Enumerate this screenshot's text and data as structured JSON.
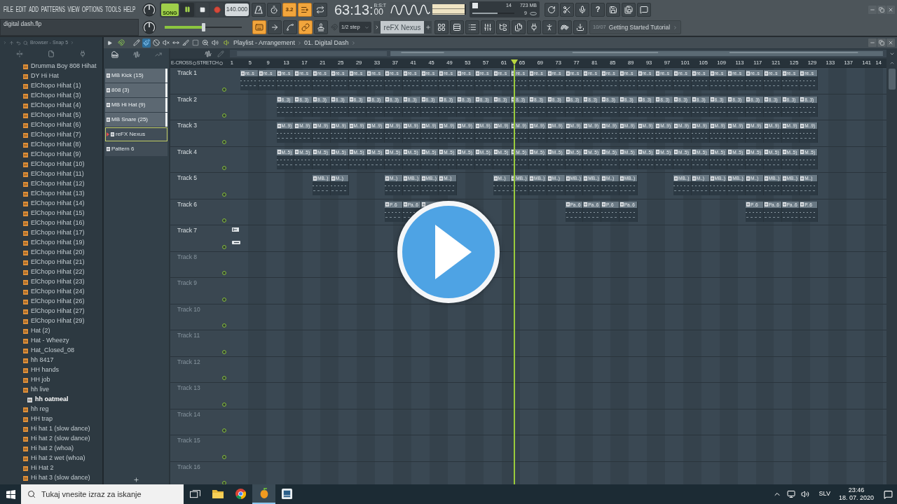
{
  "menu_bar": {
    "items": [
      "FILE",
      "EDIT",
      "ADD",
      "PATTERNS",
      "VIEW",
      "OPTIONS",
      "TOOLS",
      "HELP"
    ]
  },
  "hint_bar": {
    "text": "digital dash.flp"
  },
  "transport": {
    "mode_label": "SONG",
    "song_mode": true,
    "playing": true,
    "tempo": "140.000",
    "master_volume": {
      "level": 0.5
    }
  },
  "time_display": {
    "value": "63:13:",
    "ticks": "00",
    "format": "B:S:T"
  },
  "output_meter": {
    "level": 0.95
  },
  "performance": {
    "cpu": "14",
    "memory": "723 MB",
    "polyphony": "9",
    "load": {
      "level": 0.6
    }
  },
  "mode_buttons": [
    {
      "kind": "metronome",
      "on": false
    },
    {
      "kind": "timer",
      "on": false
    },
    {
      "kind": "countdown",
      "label": "3.2",
      "on": true
    },
    {
      "kind": "step-edit",
      "on": true
    },
    {
      "kind": "loop",
      "on": false
    }
  ],
  "record_buttons": [
    {
      "kind": "keyboard",
      "on": true
    },
    {
      "kind": "arrow",
      "on": false
    },
    {
      "kind": "spline",
      "on": false
    },
    {
      "kind": "link",
      "on": true
    },
    {
      "kind": "stamp",
      "on": false
    }
  ],
  "system_buttons": [
    {
      "kind": "refresh"
    },
    {
      "kind": "scissors"
    },
    {
      "kind": "microphone"
    },
    {
      "kind": "help",
      "label": "?"
    },
    {
      "kind": "save"
    },
    {
      "kind": "save-all"
    },
    {
      "kind": "chat"
    }
  ],
  "snap": {
    "value": "1/2 step"
  },
  "pattern_selector": {
    "value": "reFX Nexus"
  },
  "window_buttons": [
    {
      "kind": "grid"
    },
    {
      "kind": "rows"
    },
    {
      "kind": "list"
    },
    {
      "kind": "sliders"
    },
    {
      "kind": "folder-tree"
    },
    {
      "kind": "files"
    },
    {
      "kind": "plug"
    },
    {
      "kind": "person"
    },
    {
      "kind": "turtle"
    },
    {
      "kind": "download"
    }
  ],
  "news": {
    "counter": "10/07",
    "title": "Getting Started Tutorial"
  },
  "browser": {
    "title": "Browser - Snap 5",
    "items": [
      {
        "label": "Drumma Boy 808 Hihat",
        "selected": false
      },
      {
        "label": "DY Hi Hat",
        "selected": false
      },
      {
        "label": "ElChopo Hihat (1)",
        "selected": false
      },
      {
        "label": "ElChopo Hihat (3)",
        "selected": false
      },
      {
        "label": "ElChopo Hihat (4)",
        "selected": false
      },
      {
        "label": "ElChopo Hihat (5)",
        "selected": false
      },
      {
        "label": "ElChopo Hihat (6)",
        "selected": false
      },
      {
        "label": "ElChopo Hihat (7)",
        "selected": false
      },
      {
        "label": "ElChopo Hihat (8)",
        "selected": false
      },
      {
        "label": "ElChopo Hihat (9)",
        "selected": false
      },
      {
        "label": "ElChopo Hihat (10)",
        "selected": false
      },
      {
        "label": "ElChopo Hihat (11)",
        "selected": false
      },
      {
        "label": "ElChopo Hihat (12)",
        "selected": false
      },
      {
        "label": "ElChopo Hihat (13)",
        "selected": false
      },
      {
        "label": "ElChopo Hihat (14)",
        "selected": false
      },
      {
        "label": "ElChopo Hihat (15)",
        "selected": false
      },
      {
        "label": "ElChopo Hihat (16)",
        "selected": false
      },
      {
        "label": "ElChopo Hihat (17)",
        "selected": false
      },
      {
        "label": "ElChopo Hihat (19)",
        "selected": false
      },
      {
        "label": "ElChopo Hihat (20)",
        "selected": false
      },
      {
        "label": "ElChopo Hihat (21)",
        "selected": false
      },
      {
        "label": "ElChopo Hihat (22)",
        "selected": false
      },
      {
        "label": "ElChopo Hihat (23)",
        "selected": false
      },
      {
        "label": "ElChopo Hihat (24)",
        "selected": false
      },
      {
        "label": "ElChopo Hihat (26)",
        "selected": false
      },
      {
        "label": "ElChopo Hihat (27)",
        "selected": false
      },
      {
        "label": "ElChopo Hihat (29)",
        "selected": false
      },
      {
        "label": "Hat (2)",
        "selected": false
      },
      {
        "label": "Hat - Wheezy",
        "selected": false
      },
      {
        "label": "Hat_Closed_08",
        "selected": false
      },
      {
        "label": "hh 8417",
        "selected": false
      },
      {
        "label": "HH hands",
        "selected": false
      },
      {
        "label": "HH job",
        "selected": false
      },
      {
        "label": "hh live",
        "selected": false
      },
      {
        "label": "hh oatmeal",
        "selected": true
      },
      {
        "label": "hh reg",
        "selected": false
      },
      {
        "label": "HH trap",
        "selected": false
      },
      {
        "label": "Hi hat 1 (slow dance)",
        "selected": false
      },
      {
        "label": "Hi hat 2 (slow dance)",
        "selected": false
      },
      {
        "label": "Hi hat 2 (whoa)",
        "selected": false
      },
      {
        "label": "Hi hat 2 wet (whoa)",
        "selected": false
      },
      {
        "label": "Hi Hat 2",
        "selected": false
      },
      {
        "label": "Hi hat 3 (slow dance)",
        "selected": false
      }
    ]
  },
  "playlist": {
    "breadcrumb": [
      "Playlist - Arrangement",
      "01. Digital Dash"
    ],
    "tools": [
      {
        "kind": "pencil",
        "selected": false
      },
      {
        "kind": "paintbrush",
        "selected": true
      },
      {
        "kind": "delete",
        "selected": false
      },
      {
        "kind": "mute",
        "selected": false
      },
      {
        "kind": "slip",
        "selected": false
      },
      {
        "kind": "slice",
        "selected": false
      },
      {
        "kind": "select",
        "selected": false
      },
      {
        "kind": "zoom",
        "selected": false
      },
      {
        "kind": "playback",
        "selected": false
      }
    ],
    "patterns": [
      {
        "label": "MB Kick (15)",
        "lit": true,
        "selected": false
      },
      {
        "label": "808 (3)",
        "lit": true,
        "selected": false
      },
      {
        "label": "MB Hi Hat (9)",
        "lit": true,
        "selected": false
      },
      {
        "label": "MB Snare (25)",
        "lit": true,
        "selected": false
      },
      {
        "label": "reFX Nexus",
        "lit": false,
        "selected": true
      },
      {
        "label": "Pattern 6",
        "lit": false,
        "selected": false
      }
    ],
    "options": [
      {
        "label": "E-CROSS",
        "checked": false
      },
      {
        "label": "STRETCH",
        "checked": false
      }
    ],
    "ruler": [
      "1",
      "5",
      "9",
      "13",
      "17",
      "21",
      "25",
      "29",
      "33",
      "37",
      "41",
      "45",
      "49",
      "53",
      "57",
      "61",
      "65",
      "69",
      "73",
      "77",
      "81",
      "85",
      "89",
      "93",
      "97",
      "101",
      "105",
      "109",
      "113",
      "117",
      "121",
      "125",
      "129",
      "133",
      "137",
      "141",
      "14"
    ],
    "playhead": {
      "level": 0.433
    },
    "tracks": [
      {
        "name": "Track 1",
        "dimmed": false,
        "clips": [
          {
            "kind": "clip",
            "label": "re..s"
          },
          {
            "kind": "clip",
            "label": "re..s"
          },
          {
            "kind": "clip",
            "label": "re..s"
          },
          {
            "kind": "clip",
            "label": "re..s"
          },
          {
            "kind": "clip",
            "label": "re..s"
          },
          {
            "kind": "clip",
            "label": "re..s"
          },
          {
            "kind": "clip",
            "label": "re..s"
          },
          {
            "kind": "clip",
            "label": "re..s"
          },
          {
            "kind": "clip",
            "label": "re..s"
          },
          {
            "kind": "clip",
            "label": "re..s"
          },
          {
            "kind": "clip",
            "label": "re..s"
          },
          {
            "kind": "clip",
            "label": "re..s"
          },
          {
            "kind": "clip",
            "label": "re..s"
          },
          {
            "kind": "clip",
            "label": "re..s"
          },
          {
            "kind": "clip",
            "label": "re..s"
          },
          {
            "kind": "clip",
            "label": "re..s"
          },
          {
            "kind": "clip",
            "label": "re..s"
          },
          {
            "kind": "clip",
            "label": "re..s"
          },
          {
            "kind": "clip",
            "label": "re..s"
          },
          {
            "kind": "clip",
            "label": "re..s"
          },
          {
            "kind": "clip",
            "label": "re..s"
          },
          {
            "kind": "clip",
            "label": "re..s"
          },
          {
            "kind": "clip",
            "label": "re..s"
          },
          {
            "kind": "clip",
            "label": "re..s"
          },
          {
            "kind": "clip",
            "label": "re..s"
          },
          {
            "kind": "clip",
            "label": "re..s"
          },
          {
            "kind": "clip",
            "label": "re..s"
          },
          {
            "kind": "clip",
            "label": "re..s"
          },
          {
            "kind": "clip",
            "label": "re..s"
          },
          {
            "kind": "clip",
            "label": "re..s"
          },
          {
            "kind": "clip",
            "label": "re..s"
          },
          {
            "kind": "clip",
            "label": "re..s"
          }
        ]
      },
      {
        "name": "Track 2",
        "dimmed": false,
        "clips": [
          {
            "kind": "gap"
          },
          {
            "kind": "gap"
          },
          {
            "kind": "clip",
            "label": "8..3)"
          },
          {
            "kind": "clip",
            "label": "8..3)"
          },
          {
            "kind": "clip",
            "label": "8..3)"
          },
          {
            "kind": "clip",
            "label": "8..3)"
          },
          {
            "kind": "clip",
            "label": "8..3)"
          },
          {
            "kind": "clip",
            "label": "8..3)"
          },
          {
            "kind": "clip",
            "label": "8..3)"
          },
          {
            "kind": "clip",
            "label": "8..3)"
          },
          {
            "kind": "clip",
            "label": "8..3)"
          },
          {
            "kind": "clip",
            "label": "8..3)"
          },
          {
            "kind": "clip",
            "label": "8..3)"
          },
          {
            "kind": "clip",
            "label": "8..3)"
          },
          {
            "kind": "clip",
            "label": "8..3)"
          },
          {
            "kind": "clip",
            "label": "8..3)"
          },
          {
            "kind": "clip",
            "label": "8..3)"
          },
          {
            "kind": "clip",
            "label": "8..3)"
          },
          {
            "kind": "clip",
            "label": "8..3)"
          },
          {
            "kind": "clip",
            "label": "8..3)"
          },
          {
            "kind": "clip",
            "label": "8..3)"
          },
          {
            "kind": "clip",
            "label": "8..3)"
          },
          {
            "kind": "clip",
            "label": "8..3)"
          },
          {
            "kind": "clip",
            "label": "8..3)"
          },
          {
            "kind": "clip",
            "label": "8..3)"
          },
          {
            "kind": "clip",
            "label": "8..3)"
          },
          {
            "kind": "clip",
            "label": "8..3)"
          },
          {
            "kind": "clip",
            "label": "8..3)"
          },
          {
            "kind": "clip",
            "label": "8..3)"
          },
          {
            "kind": "clip",
            "label": "8..3)"
          },
          {
            "kind": "clip",
            "label": "8..3)"
          },
          {
            "kind": "clip",
            "label": "8..3)"
          }
        ]
      },
      {
        "name": "Track 3",
        "dimmed": false,
        "clips": [
          {
            "kind": "gap"
          },
          {
            "kind": "gap"
          },
          {
            "kind": "clip",
            "label": "M..9)"
          },
          {
            "kind": "clip",
            "label": "M..9)"
          },
          {
            "kind": "clip",
            "label": "M..9)"
          },
          {
            "kind": "clip",
            "label": "M..9)"
          },
          {
            "kind": "clip",
            "label": "M..9)"
          },
          {
            "kind": "clip",
            "label": "M..9)"
          },
          {
            "kind": "clip",
            "label": "M..9)"
          },
          {
            "kind": "clip",
            "label": "M..9)"
          },
          {
            "kind": "clip",
            "label": "M..9)"
          },
          {
            "kind": "clip",
            "label": "M..9)"
          },
          {
            "kind": "clip",
            "label": "M..9)"
          },
          {
            "kind": "clip",
            "label": "M..9)"
          },
          {
            "kind": "clip",
            "label": "M..9)"
          },
          {
            "kind": "clip",
            "label": "M..9)"
          },
          {
            "kind": "clip",
            "label": "M..9)"
          },
          {
            "kind": "clip",
            "label": "M..9)"
          },
          {
            "kind": "clip",
            "label": "M..9)"
          },
          {
            "kind": "clip",
            "label": "M..9)"
          },
          {
            "kind": "clip",
            "label": "M..9)"
          },
          {
            "kind": "clip",
            "label": "M..9)"
          },
          {
            "kind": "clip",
            "label": "M..9)"
          },
          {
            "kind": "clip",
            "label": "M..9)"
          },
          {
            "kind": "clip",
            "label": "M..9)"
          },
          {
            "kind": "clip",
            "label": "M..9)"
          },
          {
            "kind": "clip",
            "label": "M..9)"
          },
          {
            "kind": "clip",
            "label": "M..9)"
          },
          {
            "kind": "clip",
            "label": "M..9)"
          },
          {
            "kind": "clip",
            "label": "M..9)"
          },
          {
            "kind": "clip",
            "label": "M..9)"
          },
          {
            "kind": "clip",
            "label": "M..9)"
          }
        ]
      },
      {
        "name": "Track 4",
        "dimmed": false,
        "clips": [
          {
            "kind": "gap"
          },
          {
            "kind": "gap"
          },
          {
            "kind": "clip",
            "label": "M..5)"
          },
          {
            "kind": "clip",
            "label": "M..5)"
          },
          {
            "kind": "clip",
            "label": "M..5)"
          },
          {
            "kind": "clip",
            "label": "M..5)"
          },
          {
            "kind": "clip",
            "label": "M..5)"
          },
          {
            "kind": "clip",
            "label": "M..5)"
          },
          {
            "kind": "clip",
            "label": "M..5)"
          },
          {
            "kind": "clip",
            "label": "M..5)"
          },
          {
            "kind": "clip",
            "label": "M..5)"
          },
          {
            "kind": "clip",
            "label": "M..5)"
          },
          {
            "kind": "clip",
            "label": "M..5)"
          },
          {
            "kind": "clip",
            "label": "M..5)"
          },
          {
            "kind": "clip",
            "label": "M..5)"
          },
          {
            "kind": "clip",
            "label": "M..5)"
          },
          {
            "kind": "clip",
            "label": "M..5)"
          },
          {
            "kind": "clip",
            "label": "M..5)"
          },
          {
            "kind": "clip",
            "label": "M..5)"
          },
          {
            "kind": "clip",
            "label": "M..5)"
          },
          {
            "kind": "clip",
            "label": "M..5)"
          },
          {
            "kind": "clip",
            "label": "M..5)"
          },
          {
            "kind": "clip",
            "label": "M..5)"
          },
          {
            "kind": "clip",
            "label": "M..5)"
          },
          {
            "kind": "clip",
            "label": "M..5)"
          },
          {
            "kind": "clip",
            "label": "M..5)"
          },
          {
            "kind": "clip",
            "label": "M..5)"
          },
          {
            "kind": "clip",
            "label": "M..5)"
          },
          {
            "kind": "clip",
            "label": "M..5)"
          },
          {
            "kind": "clip",
            "label": "M..5)"
          },
          {
            "kind": "clip",
            "label": "M..5)"
          },
          {
            "kind": "clip",
            "label": "M..5)"
          }
        ]
      },
      {
        "name": "Track 5",
        "dimmed": false,
        "clips": [
          {
            "kind": "gap"
          },
          {
            "kind": "gap"
          },
          {
            "kind": "gap"
          },
          {
            "kind": "gap"
          },
          {
            "kind": "clip",
            "label": "MB..)"
          },
          {
            "kind": "clip",
            "label": "M..)"
          },
          {
            "kind": "gap"
          },
          {
            "kind": "gap"
          },
          {
            "kind": "clip",
            "label": "M..)"
          },
          {
            "kind": "clip",
            "label": "MB..)"
          },
          {
            "kind": "clip",
            "label": "MB..)"
          },
          {
            "kind": "clip",
            "label": "M..)"
          },
          {
            "kind": "gap"
          },
          {
            "kind": "gap"
          },
          {
            "kind": "clip",
            "label": "M..)"
          },
          {
            "kind": "clip",
            "label": "MB..)"
          },
          {
            "kind": "clip",
            "label": "MB..)"
          },
          {
            "kind": "clip",
            "label": "M..)"
          },
          {
            "kind": "clip",
            "label": "MB..)"
          },
          {
            "kind": "clip",
            "label": "MB..)"
          },
          {
            "kind": "clip",
            "label": "M..)"
          },
          {
            "kind": "clip",
            "label": "MB..)"
          },
          {
            "kind": "gap"
          },
          {
            "kind": "gap"
          },
          {
            "kind": "clip",
            "label": "MB..)"
          },
          {
            "kind": "clip",
            "label": "M..)"
          },
          {
            "kind": "clip",
            "label": "MB..)"
          },
          {
            "kind": "clip",
            "label": "MB..)"
          },
          {
            "kind": "clip",
            "label": "M..)"
          },
          {
            "kind": "clip",
            "label": "MB..)"
          },
          {
            "kind": "clip",
            "label": "MB..)"
          },
          {
            "kind": "clip",
            "label": "M..)"
          }
        ]
      },
      {
        "name": "Track 6",
        "dimmed": false,
        "clips": [
          {
            "kind": "gap"
          },
          {
            "kind": "gap"
          },
          {
            "kind": "gap"
          },
          {
            "kind": "gap"
          },
          {
            "kind": "gap"
          },
          {
            "kind": "gap"
          },
          {
            "kind": "gap"
          },
          {
            "kind": "gap"
          },
          {
            "kind": "clip",
            "label": "P..6"
          },
          {
            "kind": "clip",
            "label": "Pa..6"
          },
          {
            "kind": "clip"
          },
          {
            "kind": "gap"
          },
          {
            "kind": "gap"
          },
          {
            "kind": "gap"
          },
          {
            "kind": "gap"
          },
          {
            "kind": "gap"
          },
          {
            "kind": "gap"
          },
          {
            "kind": "gap"
          },
          {
            "kind": "clip",
            "label": "Pa..6"
          },
          {
            "kind": "clip",
            "label": "Pa..6"
          },
          {
            "kind": "clip",
            "label": "P..6"
          },
          {
            "kind": "clip",
            "label": "Pa..6"
          },
          {
            "kind": "gap"
          },
          {
            "kind": "gap"
          },
          {
            "kind": "gap"
          },
          {
            "kind": "gap"
          },
          {
            "kind": "gap"
          },
          {
            "kind": "gap"
          },
          {
            "kind": "clip",
            "label": "P..6"
          },
          {
            "kind": "clip",
            "label": "Pa..6"
          },
          {
            "kind": "clip",
            "label": "Pa..6"
          },
          {
            "kind": "clip",
            "label": "P..6"
          }
        ]
      },
      {
        "name": "Track 7",
        "dimmed": false,
        "markers": [
          {
            "kind": "arrow"
          },
          {
            "kind": "dash"
          }
        ]
      },
      {
        "name": "Track 8",
        "dimmed": true
      },
      {
        "name": "Track 9",
        "dimmed": true
      },
      {
        "name": "Track 10",
        "dimmed": true
      },
      {
        "name": "Track 11",
        "dimmed": true
      },
      {
        "name": "Track 12",
        "dimmed": true
      },
      {
        "name": "Track 13",
        "dimmed": true
      },
      {
        "name": "Track 14",
        "dimmed": true
      },
      {
        "name": "Track 15",
        "dimmed": true
      },
      {
        "name": "Track 16",
        "dimmed": true
      }
    ]
  },
  "taskbar": {
    "search": {
      "placeholder": "Tukaj vnesite izraz za iskanje"
    },
    "apps": [
      {
        "kind": "folder",
        "active": false
      },
      {
        "kind": "browser",
        "active": false
      },
      {
        "kind": "fruit",
        "active": true
      },
      {
        "kind": "app",
        "active": false
      }
    ],
    "language": "SLV",
    "time": "23:46",
    "date": "18. 07. 2020"
  },
  "video_overlay": {
    "play_button": true
  }
}
